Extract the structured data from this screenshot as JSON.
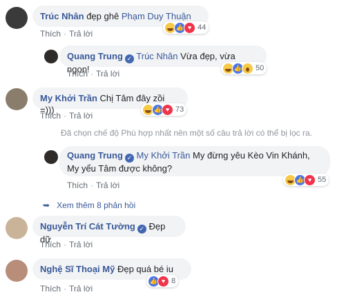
{
  "comments": [
    {
      "name": "Trúc Nhân",
      "text": "đẹp ghê",
      "tag": "Phạm Duy Thuận",
      "actions": [
        "Thích",
        "Trả lời"
      ],
      "reaction_count": "44"
    },
    {
      "name": "Quang Trung",
      "tag": "Trúc Nhân",
      "text": "Vừa đẹp, vừa ngon!",
      "actions": [
        "Thích",
        "Trả lời"
      ],
      "reaction_count": "50"
    },
    {
      "name": "My Khởi Trần",
      "text": "Chị Tâm đây zồi =)))",
      "actions": [
        "Thích",
        "Trả lời"
      ],
      "reaction_count": "73"
    },
    {
      "name": "Quang Trung",
      "tag": "My Khởi Trần",
      "text_line1": "My đừng yêu Kèo Vin Khánh,",
      "text_line2": "My yểu Tâm được không?",
      "actions": [
        "Thích",
        "Trả lời"
      ],
      "reaction_count": "55"
    },
    {
      "name": "Nguyễn Trí Cát Tường",
      "text": "Đẹp dữ",
      "actions": [
        "Thích",
        "Trả lời"
      ]
    },
    {
      "name": "Nghệ Sĩ Thoại Mỹ",
      "text": "Đẹp quá bé iu",
      "actions": [
        "Thích",
        "Trả lời"
      ],
      "reaction_count": "8"
    }
  ],
  "filter_notice": "Đã chọn chế độ Phù hợp nhất nên một số câu trả lời có thể bị lọc ra.",
  "more_replies": "Xem thêm 8 phản hồi",
  "colors": {
    "name": "#385898",
    "bubble": "#f2f3f5",
    "meta": "#606770"
  }
}
